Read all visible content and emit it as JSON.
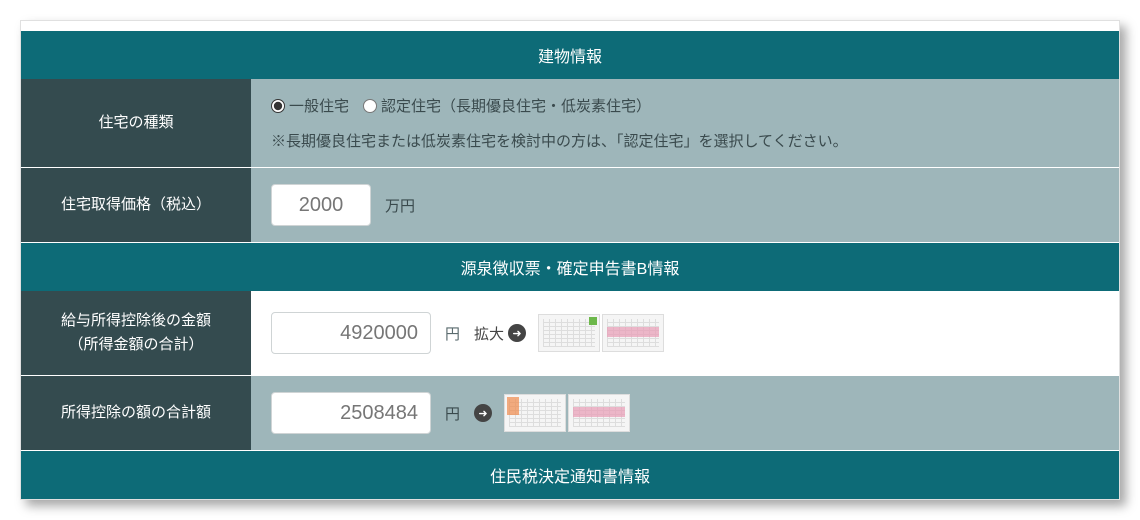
{
  "sections": {
    "building_info": "建物情報",
    "tax_info": "源泉徴収票・確定申告書B情報",
    "resident_tax": "住民税決定通知書情報"
  },
  "rows": {
    "house_type": {
      "label": "住宅の種類",
      "option1": "一般住宅",
      "option2": "認定住宅（長期優良住宅・低炭素住宅）",
      "note": "※長期優良住宅または低炭素住宅を検討中の方は、「認定住宅」を選択してください。"
    },
    "price": {
      "label": "住宅取得価格（税込）",
      "value": "2000",
      "unit": "万円"
    },
    "income": {
      "label_l1": "給与所得控除後の金額",
      "label_l2": "（所得金額の合計）",
      "value": "4920000",
      "unit": "円",
      "expand": "拡大"
    },
    "deduction": {
      "label": "所得控除の額の合計額",
      "value": "2508484",
      "unit": "円"
    }
  }
}
